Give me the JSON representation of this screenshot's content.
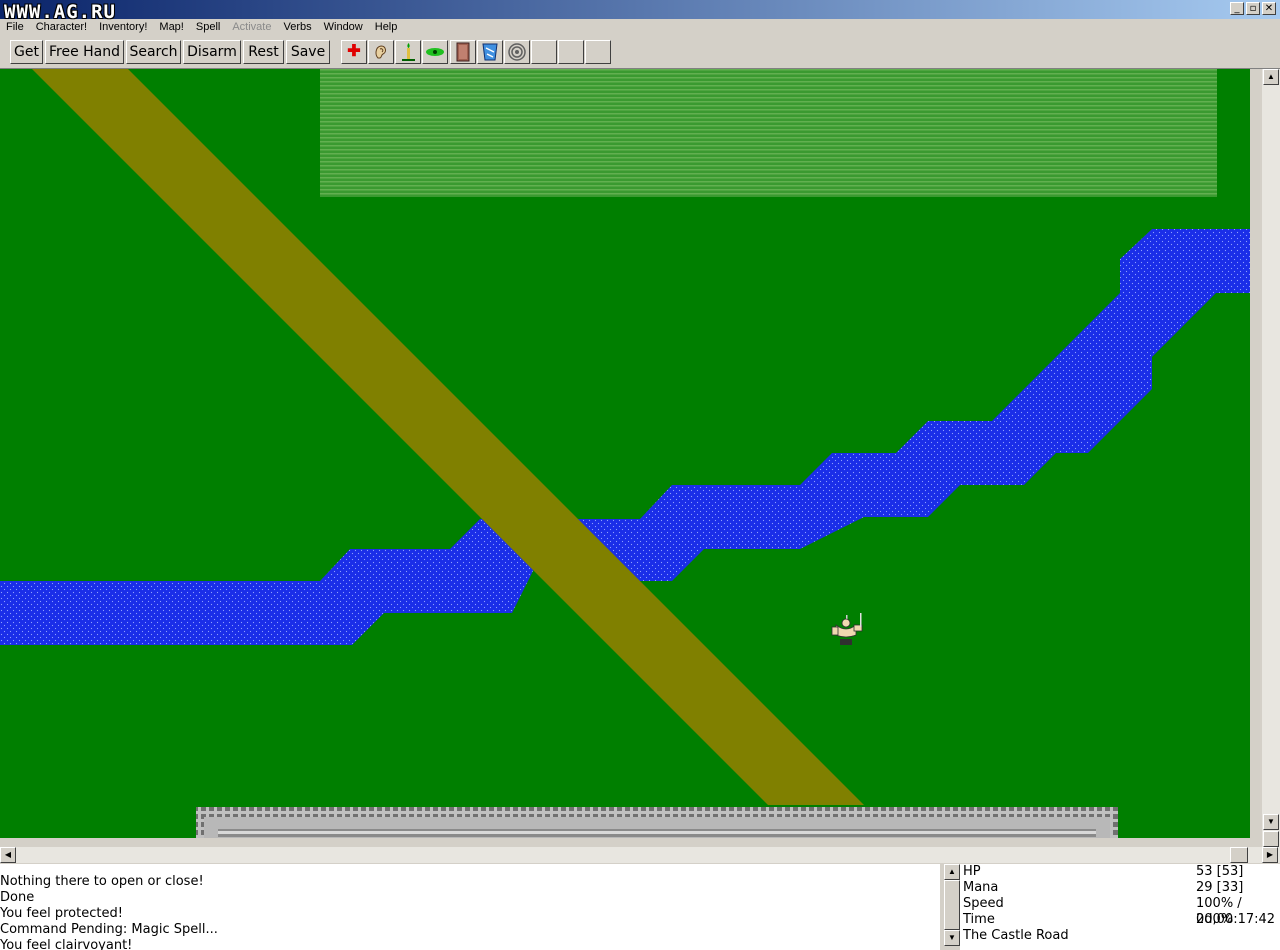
{
  "window": {
    "watermark": "WWW.AG.RU",
    "buttons": {
      "minimize": "_",
      "restore": "▫",
      "close": "✕"
    }
  },
  "menu": [
    {
      "label": "File",
      "enabled": true
    },
    {
      "label": "Character!",
      "enabled": true
    },
    {
      "label": "Inventory!",
      "enabled": true
    },
    {
      "label": "Map!",
      "enabled": true
    },
    {
      "label": "Spell",
      "enabled": true
    },
    {
      "label": "Activate",
      "enabled": false
    },
    {
      "label": "Verbs",
      "enabled": true
    },
    {
      "label": "Window",
      "enabled": true
    },
    {
      "label": "Help",
      "enabled": true
    }
  ],
  "toolbar": {
    "get": "Get",
    "free_hand": "Free Hand",
    "search": "Search",
    "disarm": "Disarm",
    "rest": "Rest",
    "save": "Save",
    "icons": [
      "red-cross-icon",
      "ear-icon",
      "candle-icon",
      "green-eye-icon",
      "door-icon",
      "blue-scroll-icon",
      "target-icon",
      "empty-slot",
      "empty-slot",
      "empty-slot"
    ]
  },
  "colors": {
    "grass": "#007f00",
    "road": "#808000",
    "water": "#1428e6",
    "field": "#4aa038",
    "wall": "#b0b0b0"
  },
  "messages": [
    "Nothing there to open or close!",
    "Done",
    "You feel protected!",
    "Command Pending: Magic Spell...",
    "You feel clairvoyant!"
  ],
  "stats": [
    {
      "label": "HP",
      "value": "53 [53]"
    },
    {
      "label": "Mana",
      "value": "29 [33]"
    },
    {
      "label": "Speed",
      "value": "100% / 200%"
    },
    {
      "label": "Time",
      "value": "0d,00:17:42"
    },
    {
      "label": "The Castle Road",
      "value": ""
    }
  ]
}
